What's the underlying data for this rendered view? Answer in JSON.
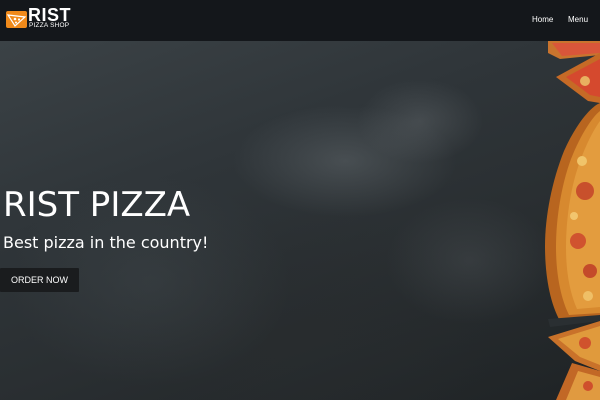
{
  "navbar": {
    "brand_title": "RIST",
    "brand_subtitle": "PIZZA SHOP",
    "logo_icon": "pizza-slice-icon",
    "links": [
      {
        "label": "Home"
      },
      {
        "label": "Menu"
      }
    ]
  },
  "hero": {
    "title": "RIST PIZZA",
    "subtitle": "Best pizza in the country!",
    "cta_label": "ORDER NOW",
    "background": "dark-stone-texture-with-pizza"
  },
  "colors": {
    "accent": "#f08a1b",
    "navbar_bg": "#14171b",
    "button_bg": "#1a1c1e",
    "text": "#ffffff"
  }
}
